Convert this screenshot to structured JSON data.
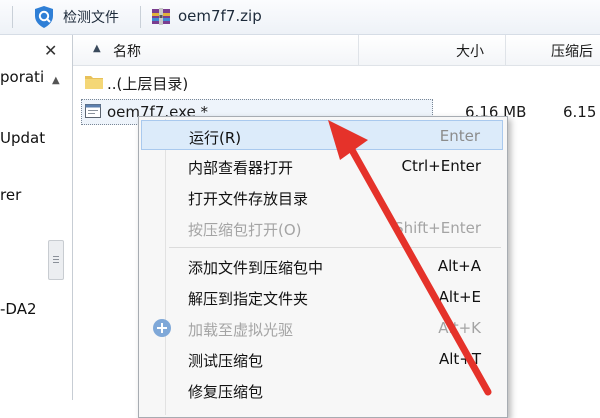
{
  "toolbar": {
    "check_file_label": "检测文件",
    "archive_title": "oem7f7.zip"
  },
  "left_panel": {
    "close_symbol": "✕",
    "items": [
      "porati",
      "Updat",
      "rer",
      "-DA2"
    ]
  },
  "list": {
    "headers": {
      "name": "名称",
      "size": "大小",
      "packed": "压缩后"
    },
    "rows": [
      {
        "name": "..(上层目录)",
        "size": "",
        "packed": ""
      },
      {
        "name": "oem7f7.exe *",
        "size": "6.16 MB",
        "packed": "6.15"
      }
    ]
  },
  "context_menu": {
    "items": [
      {
        "label": "运行(R)",
        "shortcut": "Enter"
      },
      {
        "label": "内部查看器打开",
        "shortcut": "Ctrl+Enter"
      },
      {
        "label": "打开文件存放目录",
        "shortcut": ""
      },
      {
        "label": "按压缩包打开(O)",
        "shortcut": "Shift+Enter"
      },
      {
        "label": "添加文件到压缩包中",
        "shortcut": "Alt+A"
      },
      {
        "label": "解压到指定文件夹",
        "shortcut": "Alt+E"
      },
      {
        "label": "加载至虚拟光驱",
        "shortcut": "Alt+K"
      },
      {
        "label": "测试压缩包",
        "shortcut": "Alt+T"
      },
      {
        "label": "修复压缩包",
        "shortcut": ""
      }
    ]
  },
  "icons": {
    "shield": "shield-check-icon",
    "archive": "zip-archive-icon",
    "folder": "folder-up-icon",
    "exe": "exe-file-icon",
    "disc": "virtual-disc-icon"
  },
  "colors": {
    "shield_blue": "#2f7fd6",
    "menu_highlight": "#dcebfa",
    "arrow_red": "#e5322a"
  }
}
